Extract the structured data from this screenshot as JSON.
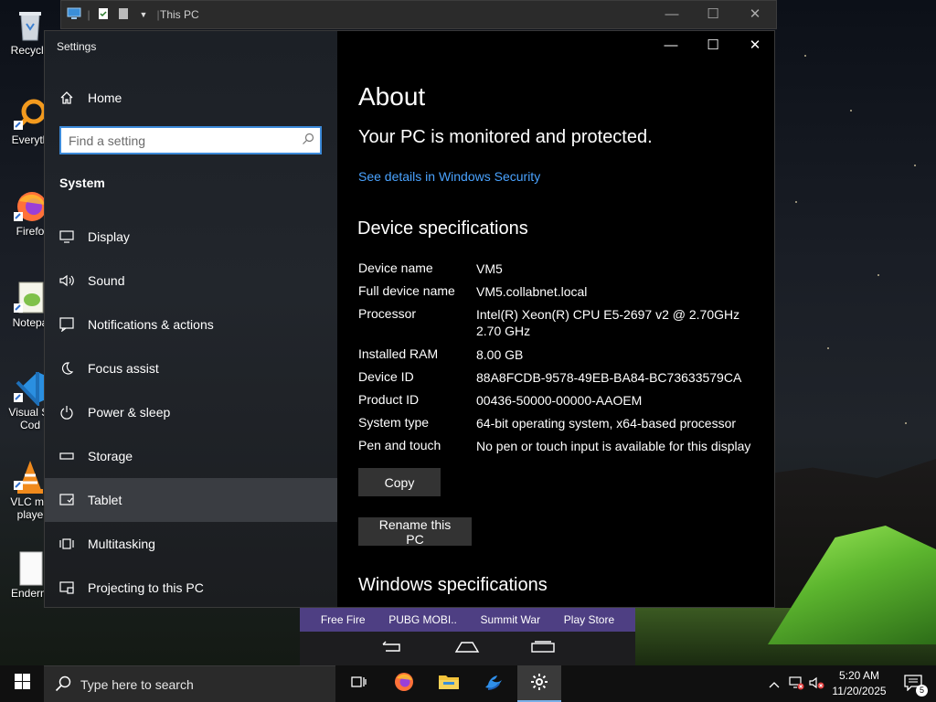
{
  "desktop": {
    "icons": [
      {
        "label": "Recycle",
        "icon": "recycle-bin-icon"
      },
      {
        "label": "Everyth",
        "icon": "everything-search-icon"
      },
      {
        "label": "Firefo",
        "icon": "firefox-icon"
      },
      {
        "label": "Notepa",
        "icon": "notepad-plus-plus-icon"
      },
      {
        "label": "Visual St",
        "label2": "Cod",
        "icon": "vscode-icon"
      },
      {
        "label": "VLC me",
        "label2": "playe",
        "icon": "vlc-icon"
      },
      {
        "label": "Enderm",
        "icon": "file-icon"
      }
    ]
  },
  "explorer": {
    "title": "This PC",
    "minimize": "—",
    "maximize": "☐",
    "close": "✕"
  },
  "settings": {
    "window_title": "Settings",
    "home_label": "Home",
    "search_placeholder": "Find a setting",
    "section_title": "System",
    "nav": [
      {
        "label": "Display",
        "icon": "monitor-icon"
      },
      {
        "label": "Sound",
        "icon": "speaker-icon"
      },
      {
        "label": "Notifications & actions",
        "icon": "notification-icon"
      },
      {
        "label": "Focus assist",
        "icon": "moon-icon"
      },
      {
        "label": "Power & sleep",
        "icon": "power-icon"
      },
      {
        "label": "Storage",
        "icon": "storage-icon"
      },
      {
        "label": "Tablet",
        "icon": "tablet-icon",
        "active": true
      },
      {
        "label": "Multitasking",
        "icon": "multitasking-icon"
      },
      {
        "label": "Projecting to this PC",
        "icon": "projecting-icon"
      }
    ],
    "about": {
      "title": "About",
      "protection_status": "Your PC is monitored and protected.",
      "security_link": "See details in Windows Security",
      "device_specs_title": "Device specifications",
      "specs": [
        {
          "key": "Device name",
          "value": "VM5"
        },
        {
          "key": "Full device name",
          "value": "VM5.collabnet.local"
        },
        {
          "key": "Processor",
          "value": "Intel(R) Xeon(R) CPU E5-2697 v2 @ 2.70GHz",
          "value2": "2.70 GHz"
        },
        {
          "key": "Installed RAM",
          "value": "8.00 GB"
        },
        {
          "key": "Device ID",
          "value": "88A8FCDB-9578-49EB-BA84-BC73633579CA"
        },
        {
          "key": "Product ID",
          "value": "00436-50000-00000-AAOEM"
        },
        {
          "key": "System type",
          "value": "64-bit operating system, x64-based processor"
        },
        {
          "key": "Pen and touch",
          "value": "No pen or touch input is available for this display"
        }
      ],
      "copy_button": "Copy",
      "rename_button": "Rename this PC",
      "windows_specs_title": "Windows specifications"
    }
  },
  "emulator": {
    "apps": [
      "Free Fire",
      "PUBG MOBI..",
      "Summit War",
      "Play Store"
    ]
  },
  "taskbar": {
    "search_placeholder": "Type here to search",
    "time": "5:20 AM",
    "date": "11/20/2025",
    "notification_count": "5"
  },
  "colors": {
    "accent": "#3c8ad9",
    "link": "#4aa3ff",
    "content_bg": "#000000",
    "taskbar_bg": "#101010",
    "emulator_bar": "#4e3f83"
  }
}
